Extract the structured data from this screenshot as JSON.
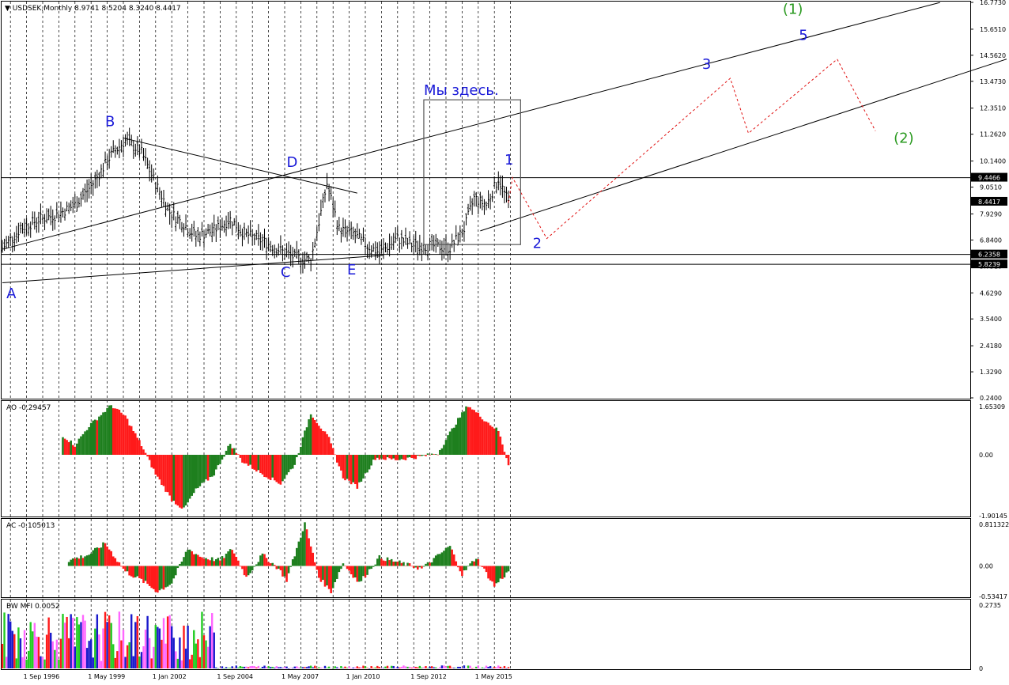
{
  "chart_data": [
    {
      "type": "ohlc",
      "title": "USDSEK,Monthly",
      "ohlc_readout": "8.9741 8.5204 8.3240 8.4417",
      "y_ticks": [
        "16.7730",
        "15.6510",
        "14.5620",
        "13.4730",
        "12.3510",
        "11.2620",
        "10.1400",
        "9.0510",
        "7.9290",
        "6.8400",
        "5.7510",
        "4.6290",
        "3.5400",
        "2.4180",
        "1.3290",
        "0.2400"
      ],
      "ylim": [
        0.24,
        16.773
      ],
      "price_badges": [
        {
          "label": "9.4466",
          "value": 9.4466,
          "style": "dark"
        },
        {
          "label": "8.4417",
          "value": 8.4417,
          "style": "dark"
        },
        {
          "label": "6.2358",
          "value": 6.2358,
          "style": "dark"
        },
        {
          "label": "5.8239",
          "value": 5.8239,
          "style": "dark"
        }
      ],
      "horizontal_levels": [
        9.4466,
        6.2358,
        5.8239
      ],
      "x_ticks": [
        "1 Sep 1996",
        "1 May 1999",
        "1 Jan 2002",
        "1 Sep 2004",
        "1 May 2007",
        "1 Jan 2010",
        "1 Sep 2012",
        "1 May 2015"
      ],
      "x_range": [
        "1995-09",
        "2016-09"
      ],
      "price_path": [
        {
          "date": "1995-09",
          "value": 6.5
        },
        {
          "date": "1996-06",
          "value": 7.3
        },
        {
          "date": "1997-03",
          "value": 7.7
        },
        {
          "date": "1997-12",
          "value": 7.9
        },
        {
          "date": "1998-09",
          "value": 8.3
        },
        {
          "date": "1999-06",
          "value": 9.2
        },
        {
          "date": "2000-03",
          "value": 10.4
        },
        {
          "date": "2000-10",
          "value": 11.0
        },
        {
          "date": "2001-06",
          "value": 10.5
        },
        {
          "date": "2002-01",
          "value": 9.2
        },
        {
          "date": "2002-08",
          "value": 8.0
        },
        {
          "date": "2003-03",
          "value": 7.5
        },
        {
          "date": "2003-09",
          "value": 7.0
        },
        {
          "date": "2004-05",
          "value": 7.2
        },
        {
          "date": "2005-02",
          "value": 7.7
        },
        {
          "date": "2005-09",
          "value": 7.1
        },
        {
          "date": "2006-06",
          "value": 6.8
        },
        {
          "date": "2007-03",
          "value": 6.4
        },
        {
          "date": "2007-10",
          "value": 6.1
        },
        {
          "date": "2008-06",
          "value": 6.0
        },
        {
          "date": "2009-02",
          "value": 9.2
        },
        {
          "date": "2009-08",
          "value": 7.3
        },
        {
          "date": "2010-03",
          "value": 7.1
        },
        {
          "date": "2010-10",
          "value": 6.6
        },
        {
          "date": "2011-04",
          "value": 6.3
        },
        {
          "date": "2012-01",
          "value": 6.9
        },
        {
          "date": "2012-09",
          "value": 6.6
        },
        {
          "date": "2013-05",
          "value": 6.6
        },
        {
          "date": "2014-03",
          "value": 6.5
        },
        {
          "date": "2014-10",
          "value": 7.3
        },
        {
          "date": "2015-03",
          "value": 8.6
        },
        {
          "date": "2015-09",
          "value": 8.3
        },
        {
          "date": "2016-03",
          "value": 9.4
        },
        {
          "date": "2016-08",
          "value": 8.4
        }
      ],
      "trend_lines": [
        {
          "from": {
            "date": "1995-09",
            "value": 6.45
          },
          "to": {
            "date": "2034-06",
            "value": 16.77
          },
          "style": "solid"
        },
        {
          "from": {
            "date": "2015-06",
            "value": 7.22
          },
          "to": {
            "date": "2037-03",
            "value": 14.4
          },
          "style": "solid"
        },
        {
          "from": {
            "date": "1995-09",
            "value": 5.05
          },
          "to": {
            "date": "2011-06",
            "value": 6.2
          },
          "style": "solid"
        },
        {
          "from": {
            "date": "2000-09",
            "value": 11.1
          },
          "to": {
            "date": "2010-05",
            "value": 8.8
          },
          "style": "solid"
        }
      ],
      "forecast_path": [
        {
          "date": "2016-08",
          "value": 8.4
        },
        {
          "date": "2016-10",
          "value": 9.45
        },
        {
          "date": "2018-03",
          "value": 6.9
        },
        {
          "date": "2025-10",
          "value": 13.6
        },
        {
          "date": "2026-07",
          "value": 11.3
        },
        {
          "date": "2030-03",
          "value": 14.4
        },
        {
          "date": "2031-10",
          "value": 11.4
        }
      ],
      "box": {
        "from": {
          "date": "2013-02",
          "value": 12.7
        },
        "to": {
          "date": "2017-02",
          "value": 6.65
        }
      },
      "wave_labels": [
        {
          "text": "A",
          "date": "1995-11",
          "value": 4.4,
          "color": "#1a1ad8"
        },
        {
          "text": "B",
          "date": "1999-12",
          "value": 11.6,
          "color": "#1a1ad8"
        },
        {
          "text": "C",
          "date": "2007-03",
          "value": 5.3,
          "color": "#1a1ad8"
        },
        {
          "text": "D",
          "date": "2007-06",
          "value": 9.9,
          "color": "#1a1ad8"
        },
        {
          "text": "E",
          "date": "2009-12",
          "value": 5.4,
          "color": "#1a1ad8"
        },
        {
          "text": "1",
          "date": "2016-06",
          "value": 10.0,
          "color": "#1a1ad8"
        },
        {
          "text": "2",
          "date": "2017-08",
          "value": 6.5,
          "color": "#1a1ad8"
        },
        {
          "text": "3",
          "date": "2024-08",
          "value": 14.0,
          "color": "#1a1ad8"
        },
        {
          "text": "5",
          "date": "2028-08",
          "value": 15.2,
          "color": "#1a1ad8"
        },
        {
          "text": "(1)",
          "date": "2028-00",
          "value": 16.3,
          "color": "#2a9a20"
        },
        {
          "text": "(2)",
          "date": "2032-07",
          "value": 10.9,
          "color": "#2a9a20"
        },
        {
          "text": "Мы здесь.",
          "date": "2013-02",
          "value": 12.9,
          "color": "#1a1ad8"
        }
      ]
    },
    {
      "type": "histogram",
      "title": "AO -0.29457",
      "y_ticks": [
        "1.65309",
        "0.00",
        "-1.90145"
      ],
      "ylim": [
        -1.90145,
        1.65309
      ],
      "up_color": "#1e7f1e",
      "down_color": "#ff1a1a",
      "values_path": [
        {
          "date": "1998-03",
          "value": 0.6
        },
        {
          "date": "1998-09",
          "value": 0.3
        },
        {
          "date": "1999-04",
          "value": 0.9
        },
        {
          "date": "2000-03",
          "value": 1.55
        },
        {
          "date": "2000-10",
          "value": 1.2
        },
        {
          "date": "2001-06",
          "value": 0.3
        },
        {
          "date": "2002-01",
          "value": -0.6
        },
        {
          "date": "2002-09",
          "value": -1.4
        },
        {
          "date": "2003-03",
          "value": -1.7
        },
        {
          "date": "2003-09",
          "value": -1.1
        },
        {
          "date": "2004-06",
          "value": -0.6
        },
        {
          "date": "2005-02",
          "value": 0.35
        },
        {
          "date": "2005-08",
          "value": -0.2
        },
        {
          "date": "2006-06",
          "value": -0.6
        },
        {
          "date": "2007-03",
          "value": -0.9
        },
        {
          "date": "2007-10",
          "value": -0.3
        },
        {
          "date": "2008-06",
          "value": 1.3
        },
        {
          "date": "2009-03",
          "value": 0.5
        },
        {
          "date": "2009-10",
          "value": -0.7
        },
        {
          "date": "2010-05",
          "value": -1.0
        },
        {
          "date": "2011-02",
          "value": -0.1
        },
        {
          "date": "2012-01",
          "value": -0.15
        },
        {
          "date": "2013-01",
          "value": -0.05
        },
        {
          "date": "2013-09",
          "value": 0.05
        },
        {
          "date": "2014-06",
          "value": 1.0
        },
        {
          "date": "2014-12",
          "value": 1.55
        },
        {
          "date": "2015-08",
          "value": 1.1
        },
        {
          "date": "2016-03",
          "value": 0.75
        },
        {
          "date": "2016-08",
          "value": -0.29
        }
      ]
    },
    {
      "type": "histogram",
      "title": "AC -0.105013",
      "y_ticks": [
        "0.811322",
        "0.00",
        "-0.53417"
      ],
      "ylim": [
        -0.53417,
        0.811322
      ],
      "up_color": "#1e7f1e",
      "down_color": "#ff1a1a",
      "values_path": [
        {
          "date": "1998-06",
          "value": 0.1
        },
        {
          "date": "1999-04",
          "value": 0.2
        },
        {
          "date": "1999-12",
          "value": 0.4
        },
        {
          "date": "2000-10",
          "value": -0.1
        },
        {
          "date": "2001-06",
          "value": -0.25
        },
        {
          "date": "2002-02",
          "value": -0.45
        },
        {
          "date": "2002-09",
          "value": -0.3
        },
        {
          "date": "2003-05",
          "value": 0.3
        },
        {
          "date": "2003-12",
          "value": 0.15
        },
        {
          "date": "2004-09",
          "value": 0.1
        },
        {
          "date": "2005-03",
          "value": 0.3
        },
        {
          "date": "2005-10",
          "value": -0.2
        },
        {
          "date": "2006-06",
          "value": 0.2
        },
        {
          "date": "2007-02",
          "value": -0.05
        },
        {
          "date": "2007-06",
          "value": -0.25
        },
        {
          "date": "2008-03",
          "value": 0.75
        },
        {
          "date": "2008-10",
          "value": -0.2
        },
        {
          "date": "2009-04",
          "value": -0.45
        },
        {
          "date": "2009-10",
          "value": 0.05
        },
        {
          "date": "2010-06",
          "value": -0.3
        },
        {
          "date": "2011-04",
          "value": 0.15
        },
        {
          "date": "2012-03",
          "value": 0.05
        },
        {
          "date": "2013-01",
          "value": -0.05
        },
        {
          "date": "2014-03",
          "value": 0.35
        },
        {
          "date": "2014-09",
          "value": -0.15
        },
        {
          "date": "2015-04",
          "value": 0.15
        },
        {
          "date": "2016-01",
          "value": -0.35
        },
        {
          "date": "2016-08",
          "value": -0.1
        }
      ]
    },
    {
      "type": "histogram",
      "title": "BW MFI 0.0052",
      "y_ticks": [
        "0.2735",
        "0"
      ],
      "ylim": [
        0,
        0.2735
      ],
      "colors": [
        "#1a1acc",
        "#22cc22",
        "#ff1a1a",
        "#ff66ff"
      ],
      "note_period_end": "2004-06"
    }
  ]
}
